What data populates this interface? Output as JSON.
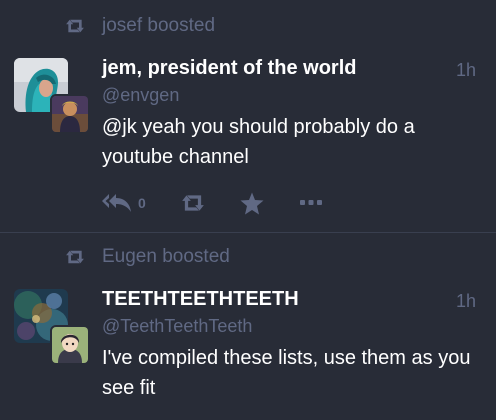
{
  "statuses": [
    {
      "booster_text": "josef boosted",
      "display_name": "jem, president of the world",
      "handle": "@envgen",
      "time": "1h",
      "content_mention": "@jk",
      "content_text": " yeah you should probably do a youtube channel",
      "reply_count": "0"
    },
    {
      "booster_text": "Eugen boosted",
      "display_name": "TEETHTEETHTEETH",
      "handle": "@TeethTeethTeeth",
      "time": "1h",
      "content_text": "I've compiled these lists, use them as you see fit"
    }
  ],
  "icons": {
    "boost": "retweet-icon",
    "reply": "reply-all-icon",
    "favourite": "star-icon",
    "more": "ellipsis-icon"
  },
  "colors": {
    "background": "#282c37",
    "muted_text": "#606984",
    "primary_text": "#ffffff",
    "divider": "#393f4f"
  }
}
